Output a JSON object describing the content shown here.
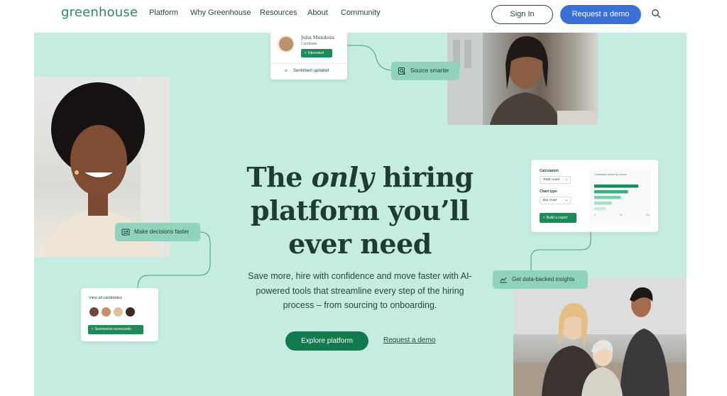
{
  "nav": {
    "logo": "greenhouse",
    "links": [
      "Platform",
      "Why Greenhouse",
      "Resources",
      "About",
      "Community"
    ],
    "sign_in": "Sign In",
    "request_demo": "Request a demo"
  },
  "hero": {
    "headline_pre": "The ",
    "headline_em": "only",
    "headline_post": " hiring platform you’ll ever need",
    "subtext": "Save more, hire with confidence and move faster with AI-powered tools that streamline every step of the hiring process – from sourcing to onboarding.",
    "cta_primary": "Explore platform",
    "cta_secondary": "Request a demo"
  },
  "candidate_card": {
    "name": "Julia Mendoza",
    "role": "Candidate",
    "badge": "Interested",
    "sentiment": "Sentiment updated"
  },
  "pills": {
    "source": "Source smarter",
    "decide": "Make decisions faster",
    "insights": "Get data-backed insights"
  },
  "report_card": {
    "calc_label": "Calculation",
    "calc_value": "Total count",
    "chart_type_label": "Chart type",
    "chart_type_value": "Bar chart",
    "button": "Build a report",
    "chart_title": "Candidates added by source",
    "bars": [
      0.86,
      0.66,
      0.52,
      0.34,
      0.22
    ],
    "ticks": [
      "0",
      "5k",
      "10k"
    ]
  },
  "view_card": {
    "title": "View all candidates",
    "button": "Summarize scorecards"
  },
  "colors": {
    "hero_bg": "#c4ece0",
    "brand_green": "#137a4e",
    "pill": "#8fd3bf",
    "demo_blue": "#3a6fd8"
  }
}
